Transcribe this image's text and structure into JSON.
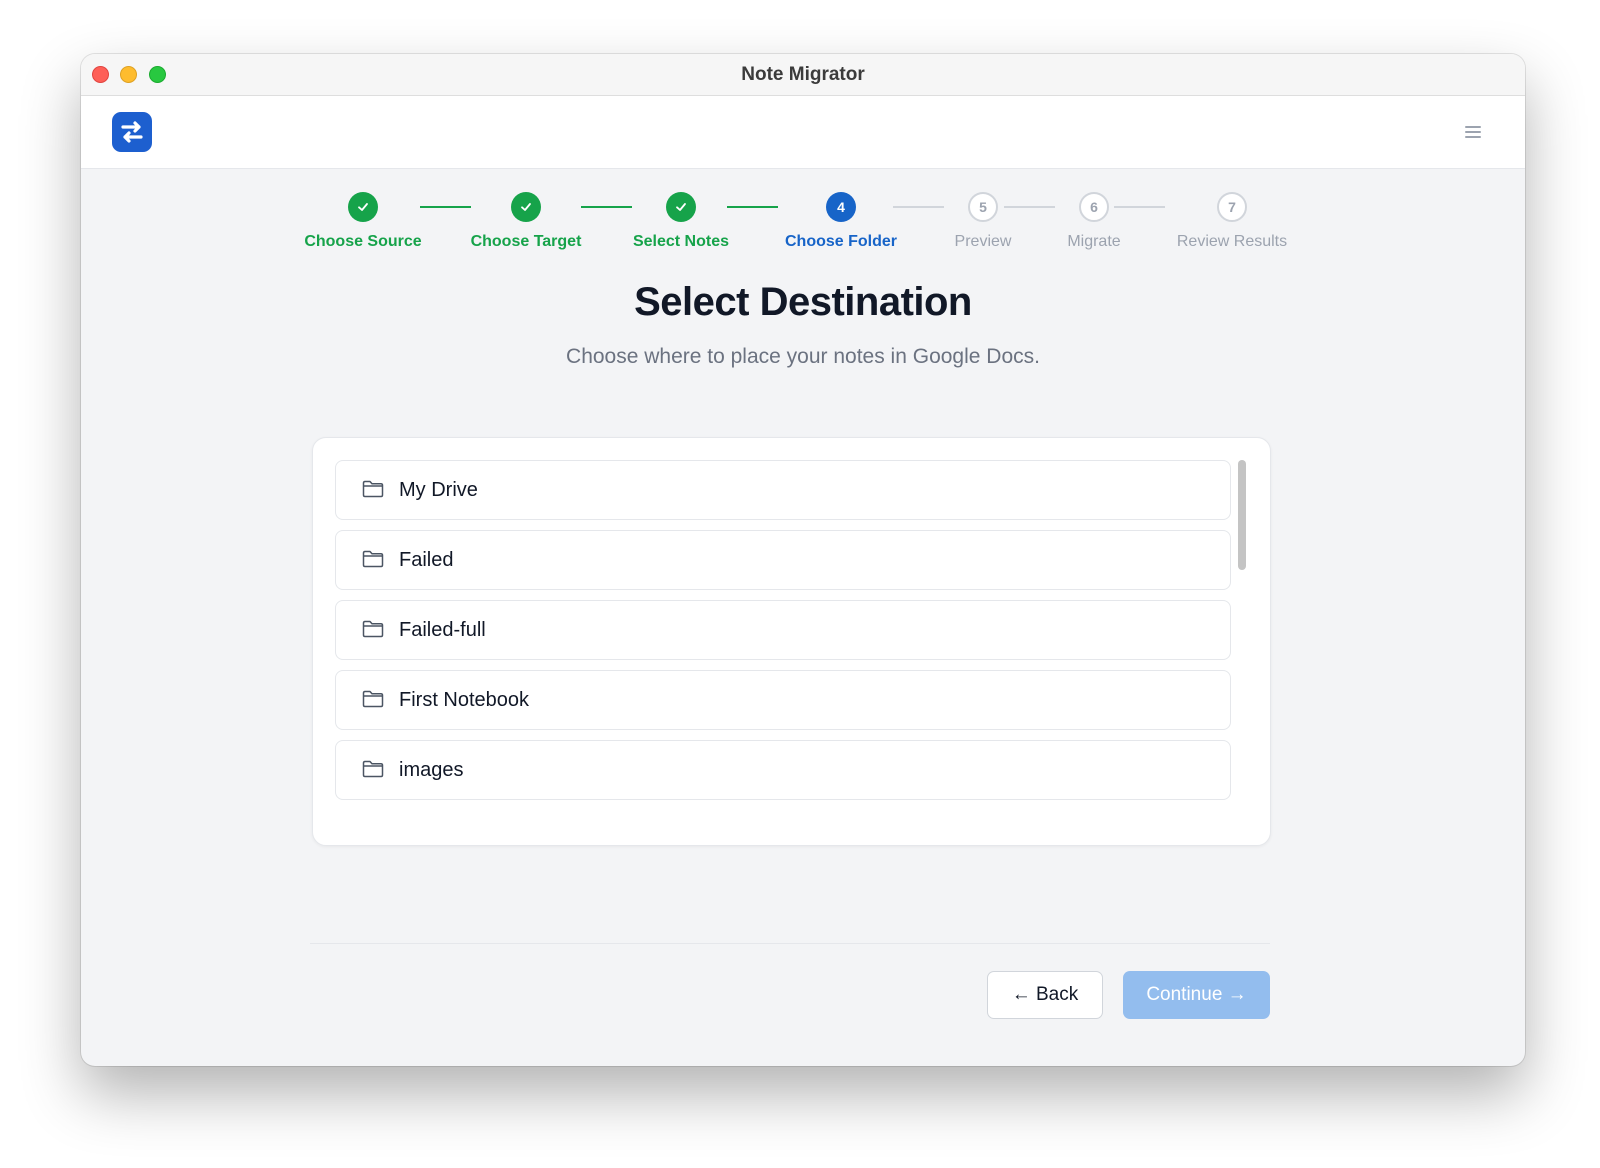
{
  "window": {
    "title": "Note Migrator"
  },
  "steps": [
    {
      "number": "1",
      "label": "Choose Source",
      "state": "done"
    },
    {
      "number": "2",
      "label": "Choose Target",
      "state": "done"
    },
    {
      "number": "3",
      "label": "Select Notes",
      "state": "done"
    },
    {
      "number": "4",
      "label": "Choose Folder",
      "state": "active"
    },
    {
      "number": "5",
      "label": "Preview",
      "state": "todo"
    },
    {
      "number": "6",
      "label": "Migrate",
      "state": "todo"
    },
    {
      "number": "7",
      "label": "Review Results",
      "state": "todo"
    }
  ],
  "page": {
    "title": "Select Destination",
    "subtitle": "Choose where to place your notes in Google Docs."
  },
  "folders": [
    {
      "name": "My Drive"
    },
    {
      "name": "Failed"
    },
    {
      "name": "Failed-full"
    },
    {
      "name": "First Notebook"
    },
    {
      "name": "images"
    }
  ],
  "footer": {
    "back_label": "← Back",
    "continue_label": "Continue →"
  },
  "icons": {
    "logo": "swap-arrows-icon",
    "menu": "hamburger-menu-icon",
    "check": "check-icon",
    "folder": "folder-icon"
  },
  "colors": {
    "success": "#16a34a",
    "primary": "#1764c8",
    "continue_disabled": "#93bdee",
    "logo_bg": "#1d5fcf"
  }
}
